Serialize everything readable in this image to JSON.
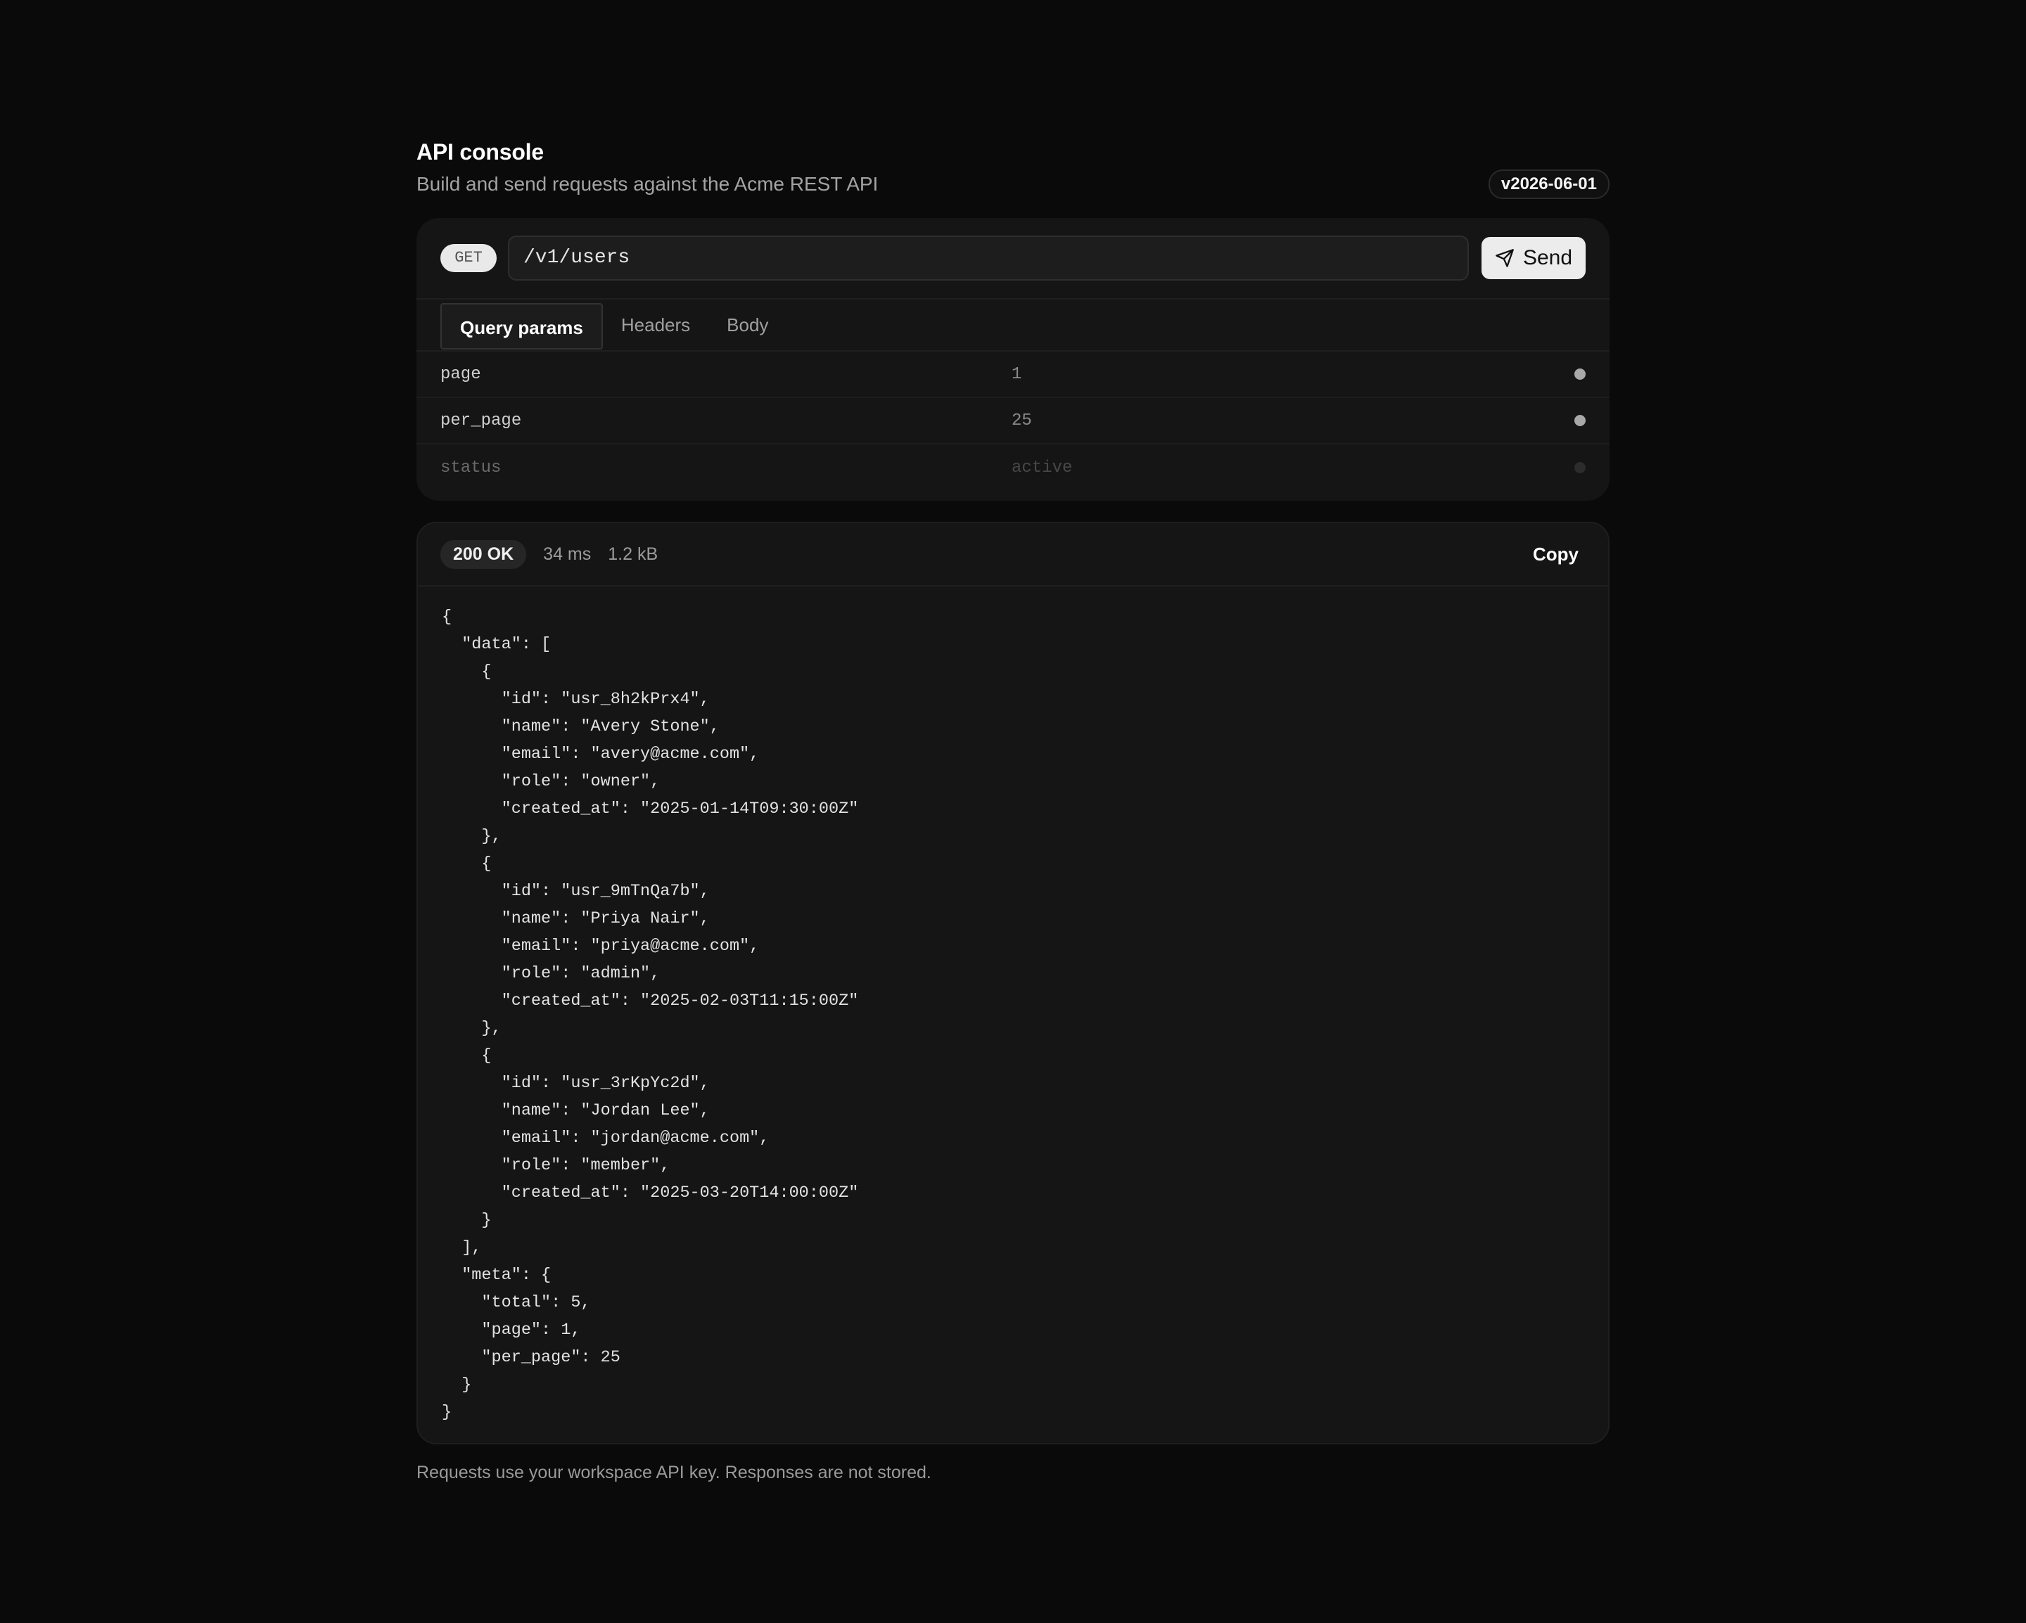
{
  "header": {
    "title": "API console",
    "subtitle": "Build and send requests against the Acme REST API",
    "version": "v2026-06-01"
  },
  "request": {
    "method": "GET",
    "url": "/v1/users",
    "send_label": "Send",
    "send_icon": "paper-plane-icon",
    "tabs": [
      {
        "label": "Query params",
        "active": true
      },
      {
        "label": "Headers",
        "active": false
      },
      {
        "label": "Body",
        "active": false
      }
    ],
    "params": [
      {
        "key": "page",
        "value": "1",
        "enabled": true
      },
      {
        "key": "per_page",
        "value": "25",
        "enabled": true
      },
      {
        "key": "status",
        "value": "active",
        "enabled": false
      }
    ]
  },
  "response": {
    "status": "200 OK",
    "time": "34 ms",
    "size": "1.2 kB",
    "copy_label": "Copy",
    "body": "{\n  \"data\": [\n    {\n      \"id\": \"usr_8h2kPrx4\",\n      \"name\": \"Avery Stone\",\n      \"email\": \"avery@acme.com\",\n      \"role\": \"owner\",\n      \"created_at\": \"2025-01-14T09:30:00Z\"\n    },\n    {\n      \"id\": \"usr_9mTnQa7b\",\n      \"name\": \"Priya Nair\",\n      \"email\": \"priya@acme.com\",\n      \"role\": \"admin\",\n      \"created_at\": \"2025-02-03T11:15:00Z\"\n    },\n    {\n      \"id\": \"usr_3rKpYc2d\",\n      \"name\": \"Jordan Lee\",\n      \"email\": \"jordan@acme.com\",\n      \"role\": \"member\",\n      \"created_at\": \"2025-03-20T14:00:00Z\"\n    }\n  ],\n  \"meta\": {\n    \"total\": 5,\n    \"page\": 1,\n    \"per_page\": 25\n  }\n}"
  },
  "footer": {
    "note": "Requests use your workspace API key. Responses are not stored."
  },
  "colors": {
    "background": "#0a0a0a",
    "card": "#151515",
    "accent": "#ececec"
  }
}
